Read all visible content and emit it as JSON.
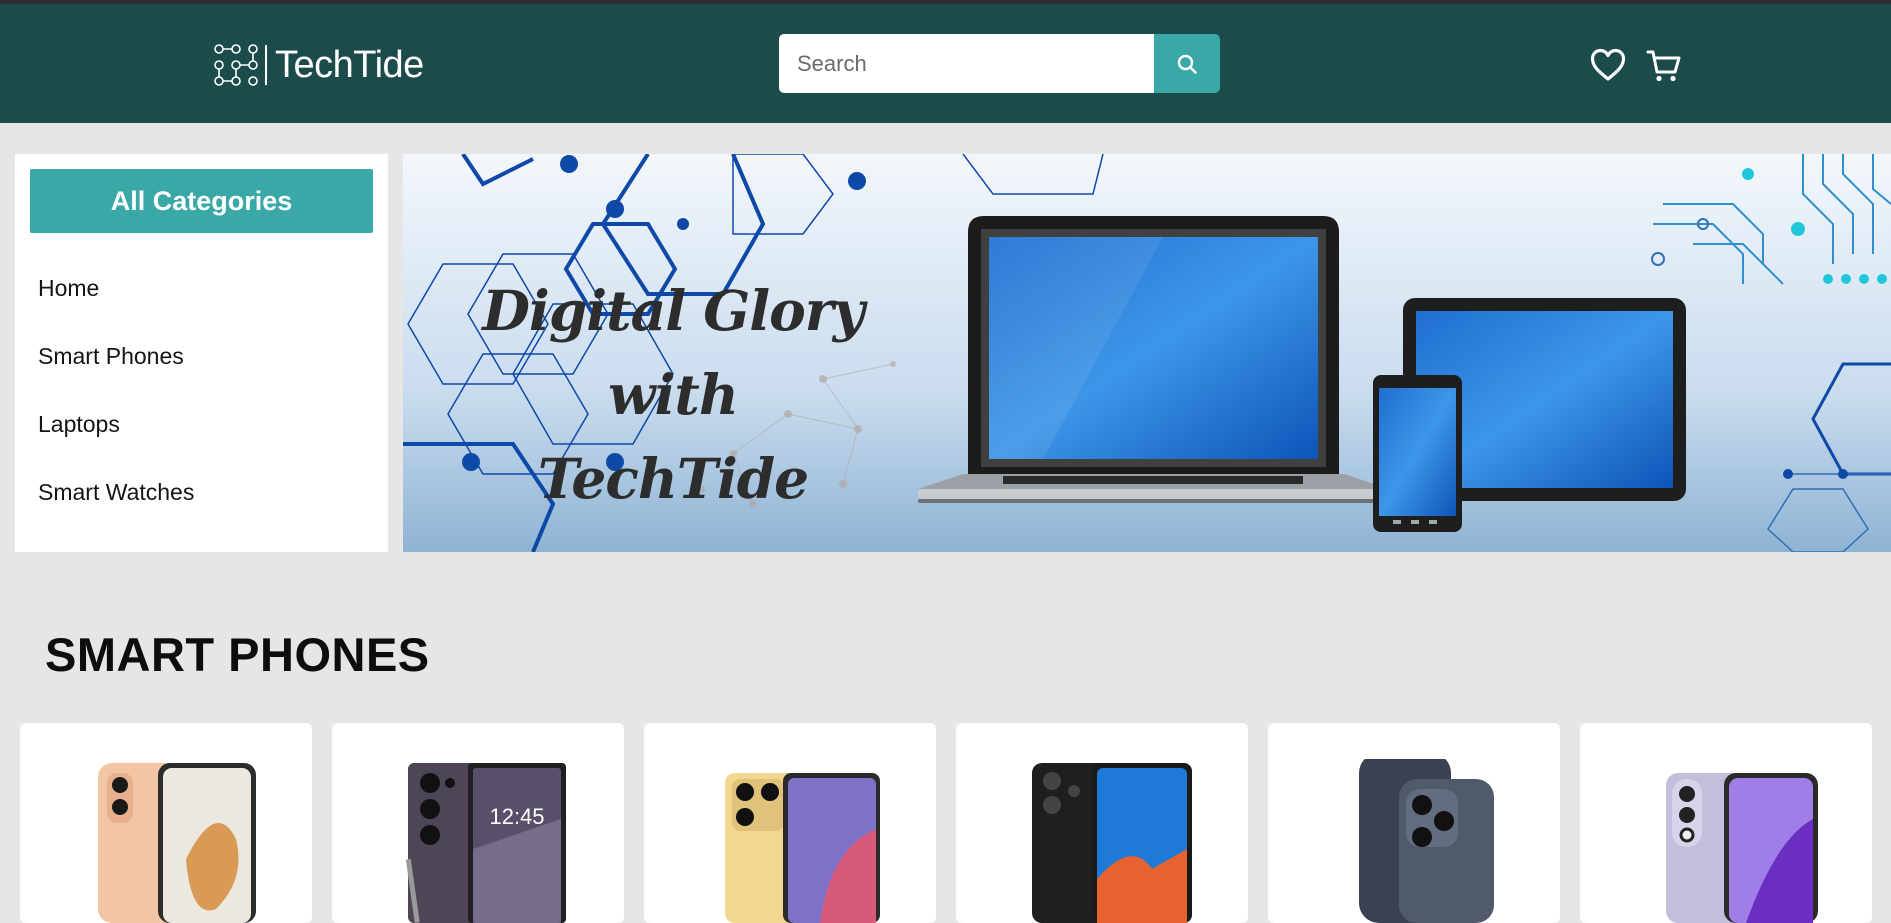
{
  "brand": {
    "name": "TechTide"
  },
  "search": {
    "placeholder": "Search"
  },
  "header": {
    "icons": [
      "heart-icon",
      "cart-icon"
    ]
  },
  "sidebar": {
    "button_label": "All Categories",
    "items": [
      {
        "label": "Home"
      },
      {
        "label": "Smart Phones"
      },
      {
        "label": "Laptops"
      },
      {
        "label": "Smart Watches"
      }
    ]
  },
  "hero": {
    "line1": "Digital Glory with",
    "line2": "TechTide"
  },
  "sections": [
    {
      "title": "SMART PHONES"
    }
  ],
  "colors": {
    "header_bg": "#1b4b4b",
    "accent": "#3aa8a6",
    "page_bg": "#e6e6e6"
  }
}
